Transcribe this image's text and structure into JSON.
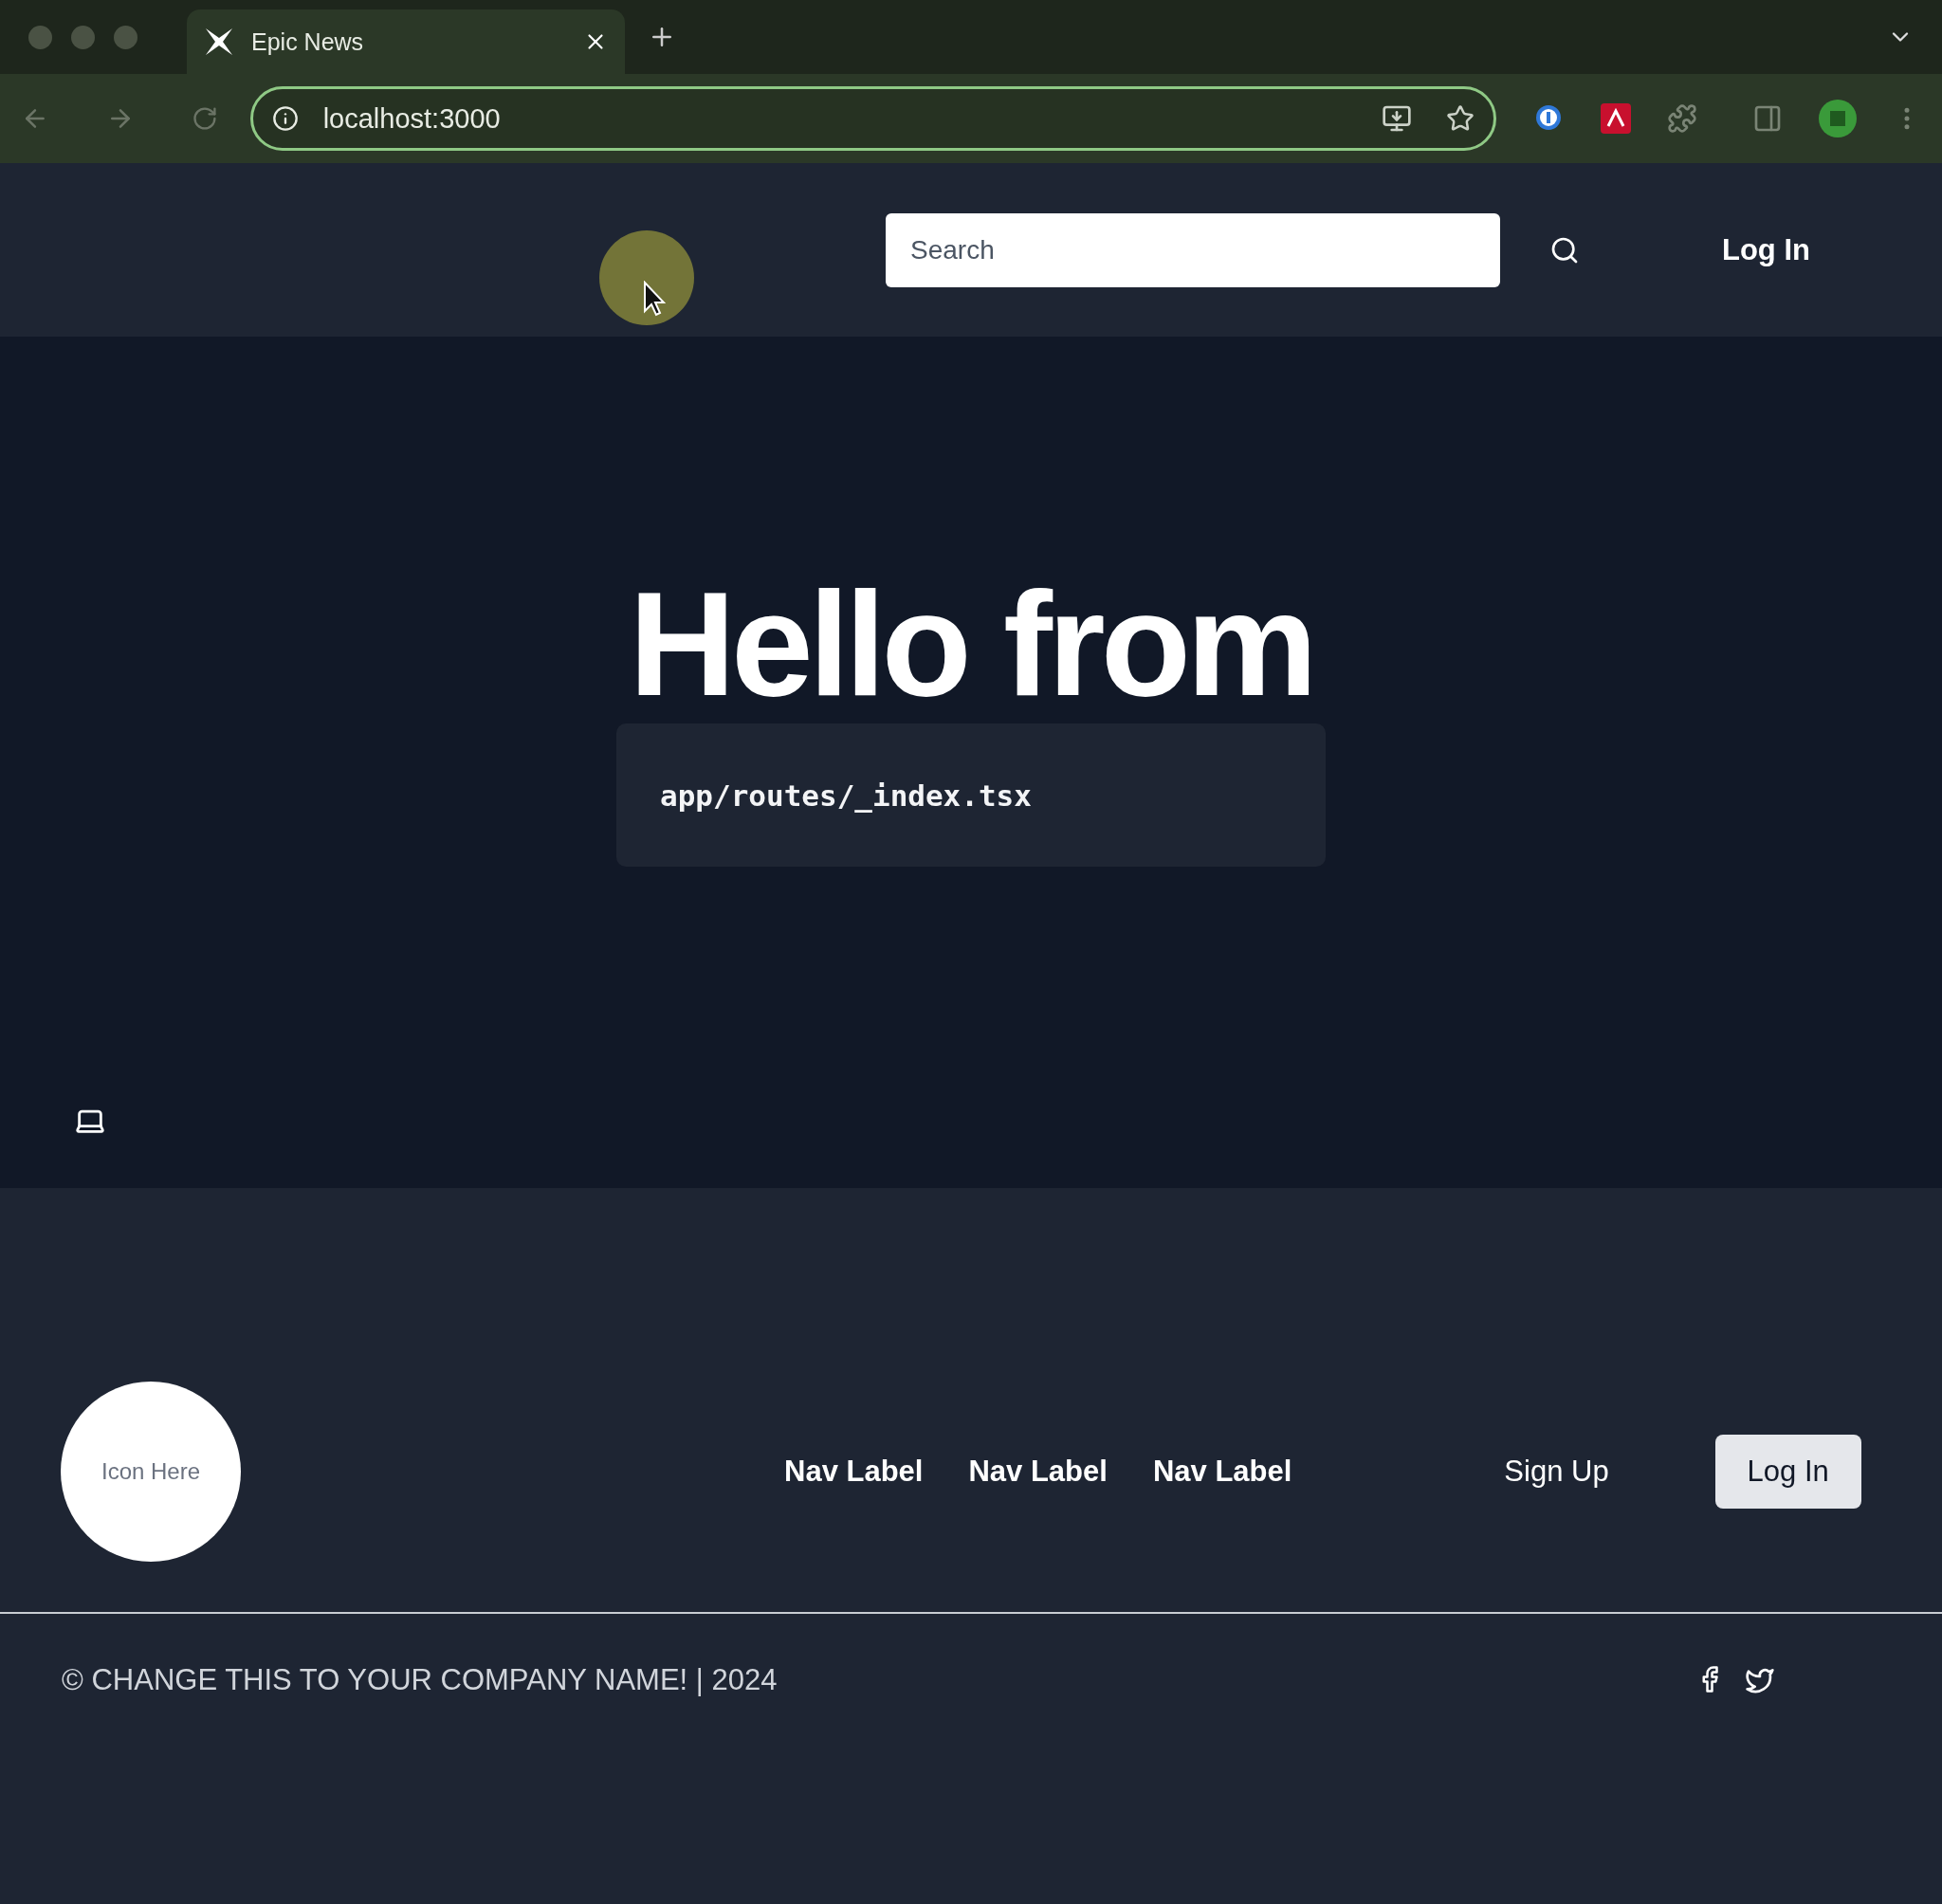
{
  "browser": {
    "tab_title": "Epic News",
    "address": "localhost:3000"
  },
  "header": {
    "search": {
      "placeholder": "Search"
    },
    "login": "Log In"
  },
  "hero": {
    "title": "Hello from",
    "code": "app/routes/_index.tsx"
  },
  "footer": {
    "logo": "Icon Here",
    "nav": [
      "Nav Label",
      "Nav Label",
      "Nav Label"
    ],
    "signup": "Sign Up",
    "login": "Log In",
    "copyright": "© CHANGE THIS TO YOUR COMPANY NAME! | 2024"
  }
}
